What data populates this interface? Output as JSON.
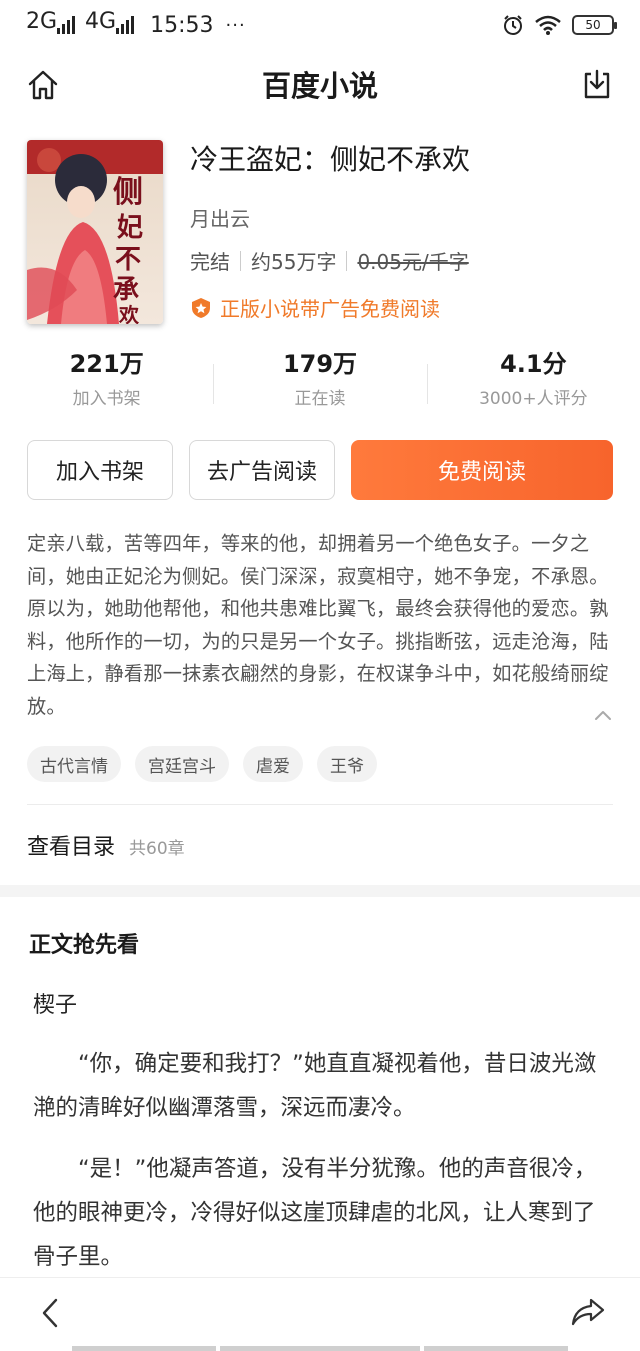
{
  "status_bar": {
    "net1": "2G",
    "net2": "4G",
    "time": "15:53",
    "dots": "···",
    "battery": "50"
  },
  "header": {
    "title": "百度小说",
    "left_icon": "home-icon",
    "right_icon": "download-icon"
  },
  "book": {
    "title": "冷王盗妃：侧妃不承欢",
    "author": "月出云",
    "status": "完结",
    "word_count": "约55万字",
    "price": "0.05元/千字",
    "promo": "正版小说带广告免费阅读"
  },
  "stats": [
    {
      "value": "221万",
      "label": "加入书架"
    },
    {
      "value": "179万",
      "label": "正在读"
    },
    {
      "value": "4.1分",
      "label": "3000+人评分"
    }
  ],
  "buttons": {
    "add_shelf": "加入书架",
    "remove_ads": "去广告阅读",
    "free_read": "免费阅读"
  },
  "synopsis": "定亲八载，苦等四年，等来的他，却拥着另一个绝色女子。一夕之间，她由正妃沦为侧妃。侯门深深，寂寞相守，她不争宠，不承恩。原以为，她助他帮他，和他共患难比翼飞，最终会获得他的爱恋。孰料，他所作的一切，为的只是另一个女子。挑指断弦，远走沧海，陆上海上，静看那一抹素衣翩然的身影，在权谋争斗中，如花般绮丽绽放。",
  "tags": [
    "古代言情",
    "宫廷宫斗",
    "虐爱",
    "王爷"
  ],
  "catalog": {
    "label": "查看目录",
    "count": "共60章"
  },
  "preview": {
    "heading": "正文抢先看",
    "chapter": "楔子",
    "paragraphs": [
      "“你，确定要和我打？”她直直凝视着他，昔日波光潋滟的清眸好似幽潭落雪，深远而凄冷。",
      "“是！”他凝声答道，没有半分犹豫。他的声音很冷，他的眼神更冷，冷得好似这崖顶肆虐的北风，让人寒到了骨子里。"
    ]
  },
  "colors": {
    "accent": "#f7642c",
    "promo": "#f07a2a"
  }
}
